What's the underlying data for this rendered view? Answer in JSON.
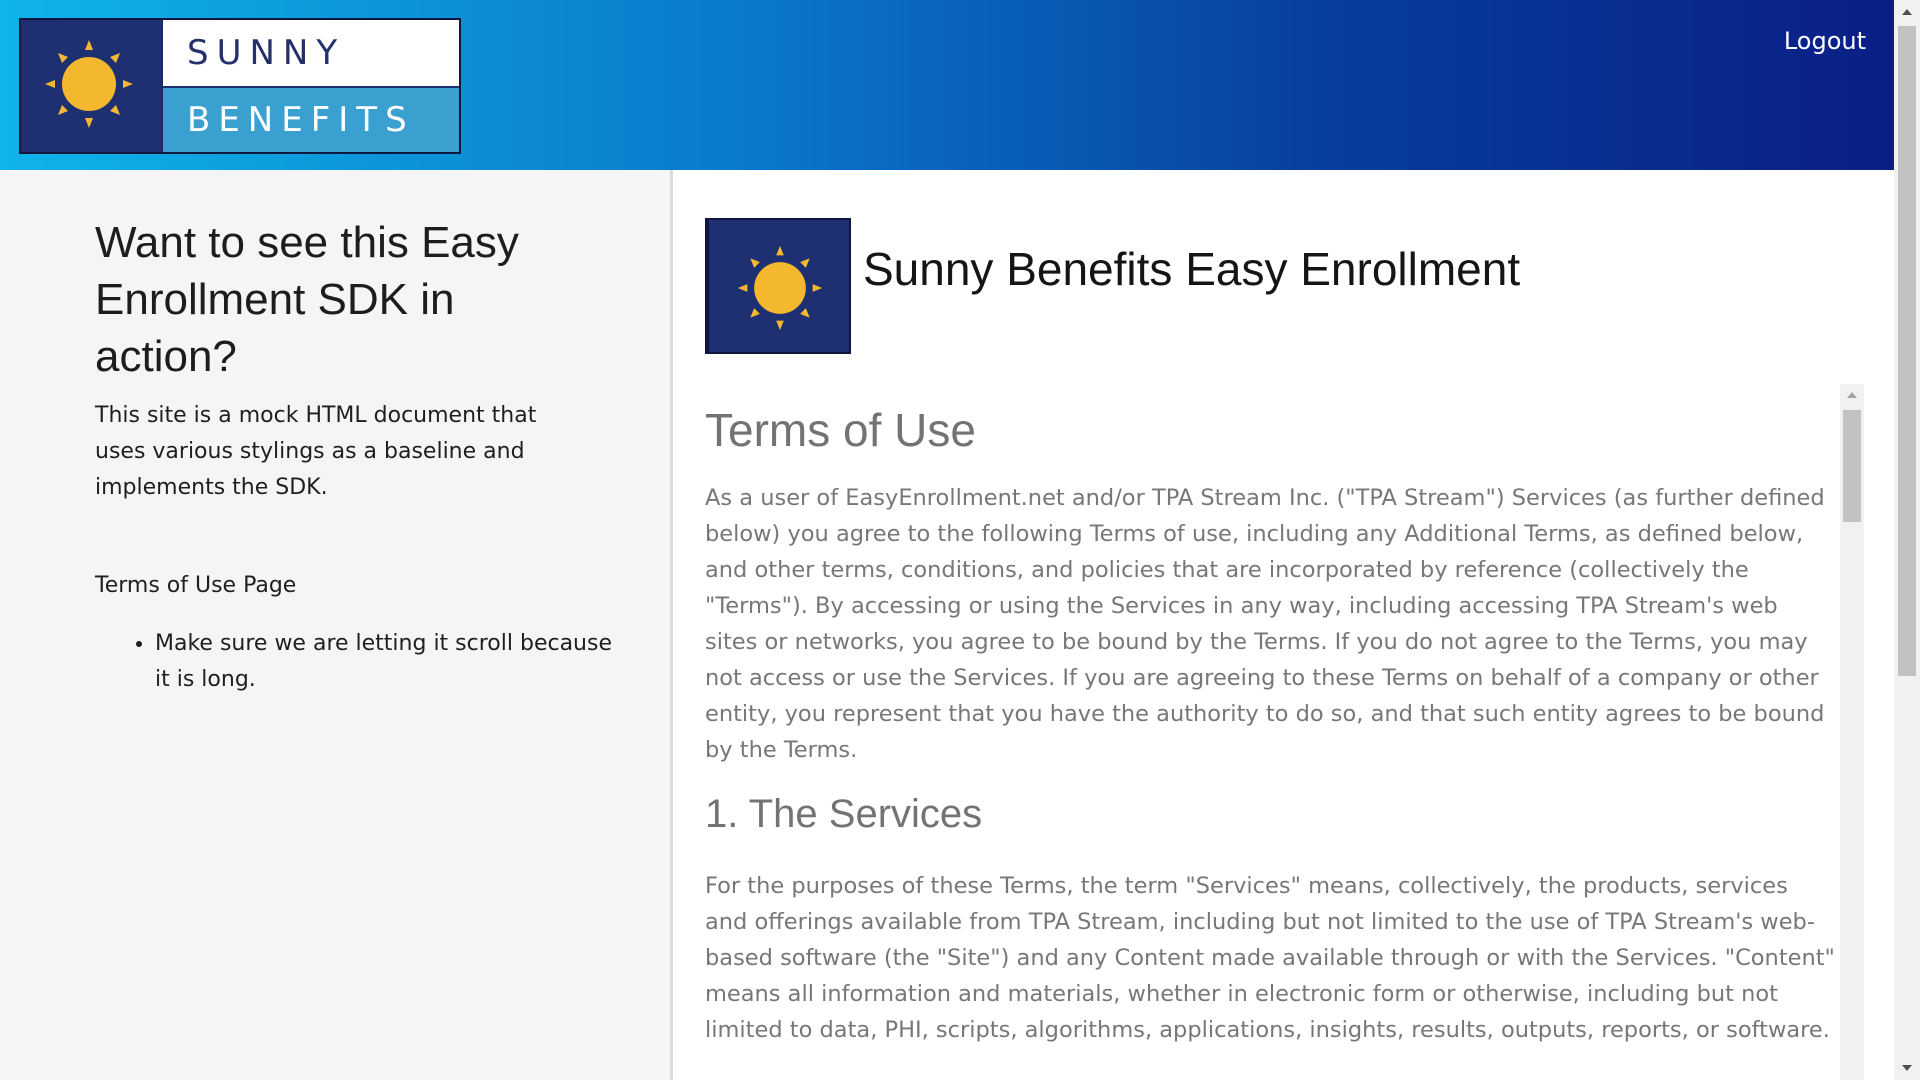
{
  "header": {
    "logo_word_top": "SUNNY",
    "logo_word_bottom": "BENEFITS",
    "logout_label": "Logout"
  },
  "sidebar": {
    "heading": "Want to see this Easy Enrollment SDK in action?",
    "description": "This site is a mock HTML document that uses various stylings as a baseline and implements the SDK.",
    "subheading": "Terms of Use Page",
    "bullets": [
      "Make sure we are letting it scroll because it is long."
    ]
  },
  "main": {
    "brand_title": "Sunny Benefits Easy Enrollment",
    "terms": {
      "title": "Terms of Use",
      "intro": "As a user of EasyEnrollment.net and/or TPA Stream Inc. (\"TPA Stream\") Services (as further defined below) you agree to the following Terms of use, including any Additional Terms, as defined below, and other terms, conditions, and policies that are incorporated by reference (collectively the \"Terms\"). By accessing or using the Services in any way, including accessing TPA Stream's web sites or networks, you agree to be bound by the Terms. If you do not agree to the Terms, you may not access or use the Services. If you are agreeing to these Terms on behalf of a company or other entity, you represent that you have the authority to do so, and that such entity agrees to be bound by the Terms.",
      "section1_title": "1. The Services",
      "section1_body": "For the purposes of these Terms, the term \"Services\" means, collectively, the products, services and offerings available from TPA Stream, including but not limited to the use of TPA Stream's web-based software (the \"Site\") and any Content made available through or with the Services. \"Content\" means all information and materials, whether in electronic form or otherwise, including but not limited to data, PHI, scripts, algorithms, applications, insights, results, outputs, reports, or software."
    }
  },
  "colors": {
    "header_gradient_start": "#0fb4ea",
    "header_gradient_end": "#0a1e86",
    "logo_navy": "#1e2f72",
    "logo_sun": "#f3b82e",
    "logo_light_blue": "#3aa0cf"
  },
  "icons": {
    "logo": "sun-icon",
    "logout": "none"
  }
}
